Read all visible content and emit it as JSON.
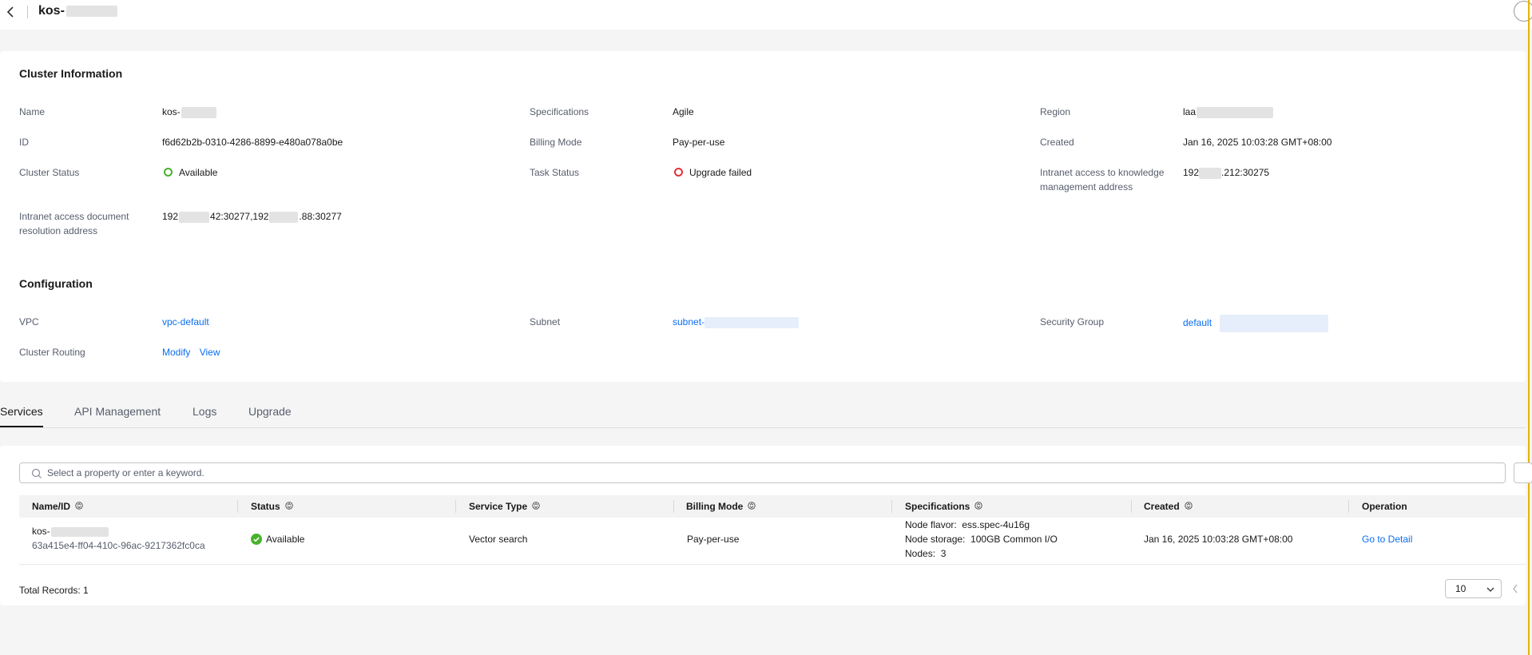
{
  "header": {
    "title": "kos-"
  },
  "cluster_info": {
    "section_title": "Cluster Information",
    "fields": {
      "name": {
        "label": "Name",
        "value": "kos-"
      },
      "specifications": {
        "label": "Specifications",
        "value": "Agile"
      },
      "region": {
        "label": "Region",
        "value": "laa"
      },
      "id": {
        "label": "ID",
        "value": "f6d62b2b-0310-4286-8899-e480a078a0be"
      },
      "billing_mode": {
        "label": "Billing Mode",
        "value": "Pay-per-use"
      },
      "created": {
        "label": "Created",
        "value": "Jan 16, 2025 10:03:28 GMT+08:00"
      },
      "cluster_status": {
        "label": "Cluster Status",
        "value": "Available"
      },
      "task_status": {
        "label": "Task Status",
        "value": "Upgrade failed"
      },
      "intranet_knowledge": {
        "label_line1": "Intranet access to knowledge",
        "label_line2": "management address",
        "value_prefix": "192",
        "value_suffix": ".212:30275"
      },
      "intranet_document": {
        "label_line1": "Intranet access document",
        "label_line2": "resolution address",
        "value_part1": "192",
        "value_part2": "42:30277,192",
        "value_part3": ".88:30277"
      }
    }
  },
  "configuration": {
    "section_title": "Configuration",
    "vpc": {
      "label": "VPC",
      "value": "vpc-default"
    },
    "subnet": {
      "label": "Subnet",
      "value": "subnet-"
    },
    "security_group": {
      "label": "Security Group",
      "value": "default"
    },
    "cluster_routing": {
      "label": "Cluster Routing",
      "modify": "Modify",
      "view": "View"
    }
  },
  "tabs": [
    {
      "label": "Services",
      "active": true
    },
    {
      "label": "API Management",
      "active": false
    },
    {
      "label": "Logs",
      "active": false
    },
    {
      "label": "Upgrade",
      "active": false
    }
  ],
  "services_table": {
    "search_placeholder": "Select a property or enter a keyword.",
    "columns": [
      "Name/ID",
      "Status",
      "Service Type",
      "Billing Mode",
      "Specifications",
      "Created",
      "Operation"
    ],
    "rows": [
      {
        "name": "kos-",
        "id": "63a415e4-ff04-410c-96ac-9217362fc0ca",
        "status": "Available",
        "service_type": "Vector search",
        "billing_mode": "Pay-per-use",
        "spec_flavor_label": "Node flavor:",
        "spec_flavor": "ess.spec-4u16g",
        "spec_storage_label": "Node storage:",
        "spec_storage": "100GB Common I/O",
        "spec_nodes_label": "Nodes:",
        "spec_nodes": "3",
        "created": "Jan 16, 2025 10:03:28 GMT+08:00",
        "operation": "Go to Detail"
      }
    ],
    "total_records": "Total Records: 1",
    "page_size": "10"
  },
  "colors": {
    "link": "#0a6ef0",
    "available": "#48b22c",
    "failed": "#e3323b",
    "accent_bar": "#e6b400"
  }
}
